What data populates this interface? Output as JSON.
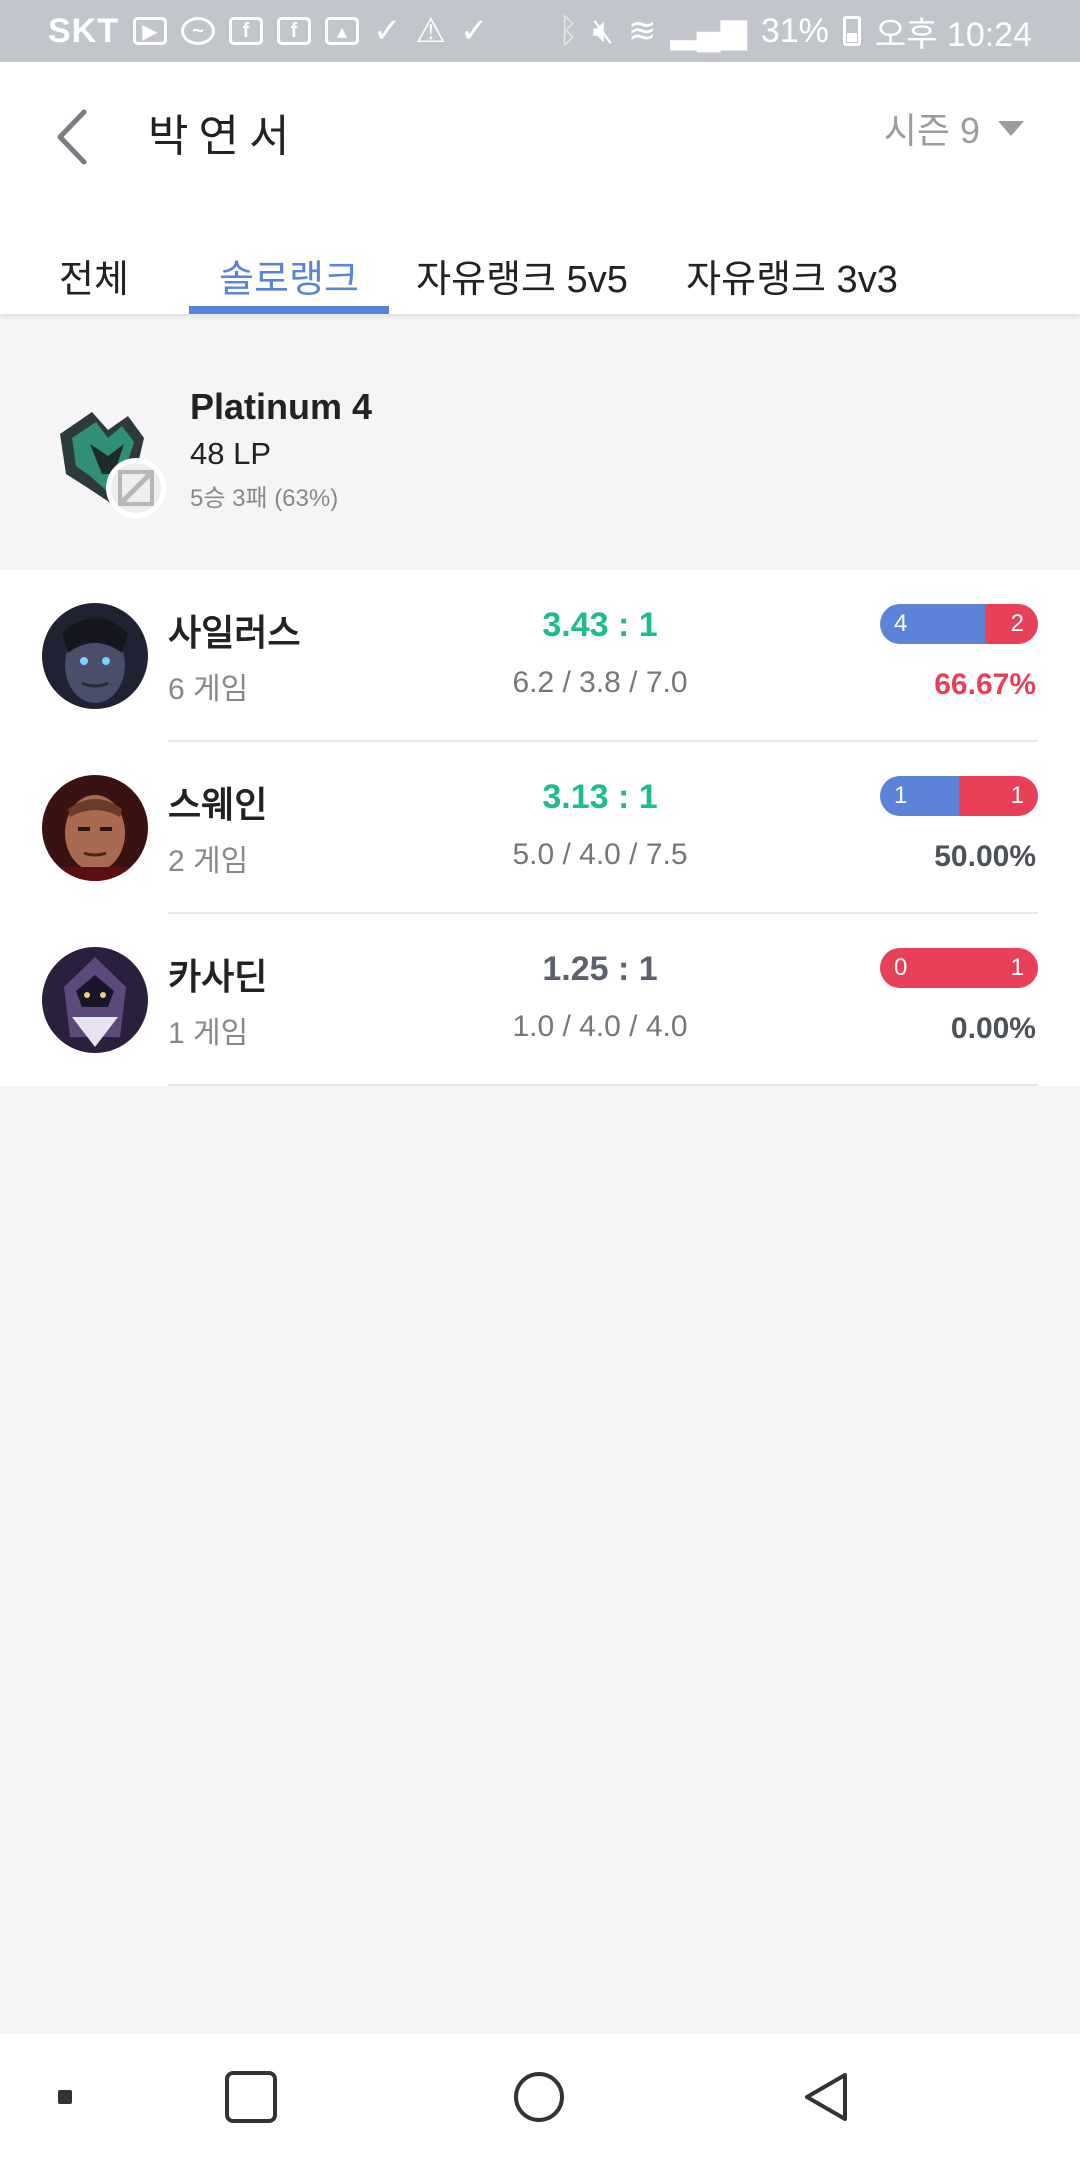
{
  "status_bar": {
    "carrier": "SKT",
    "battery": "31%",
    "time": "오후 10:24"
  },
  "header": {
    "title": "박연서",
    "season": "시즌 9"
  },
  "tabs": [
    {
      "label": "전체",
      "active": false
    },
    {
      "label": "솔로랭크",
      "active": true
    },
    {
      "label": "자유랭크 5v5",
      "active": false
    },
    {
      "label": "자유랭크 3v3",
      "active": false
    }
  ],
  "rank": {
    "tier": "Platinum 4",
    "lp": "48 LP",
    "record": "5승 3패 (63%)"
  },
  "champions": [
    {
      "name": "사일러스",
      "games": "6 게임",
      "kda": "3.43 : 1",
      "kda_detail": "6.2 / 3.8 / 7.0",
      "wins": "4",
      "losses": "2",
      "win_fraction": 0.667,
      "winrate": "66.67%"
    },
    {
      "name": "스웨인",
      "games": "2 게임",
      "kda": "3.13 : 1",
      "kda_detail": "5.0 / 4.0 / 7.5",
      "wins": "1",
      "losses": "1",
      "win_fraction": 0.5,
      "winrate": "50.00%"
    },
    {
      "name": "카사딘",
      "games": "1 게임",
      "kda": "1.25 : 1",
      "kda_detail": "1.0 / 4.0 / 4.0",
      "wins": "0",
      "losses": "1",
      "win_fraction": 0.0,
      "winrate": "0.00%"
    }
  ],
  "colors": {
    "accent": "#5b84d9",
    "win": "#5b84d9",
    "loss": "#e84057",
    "kda_good": "#1dbd8b"
  }
}
